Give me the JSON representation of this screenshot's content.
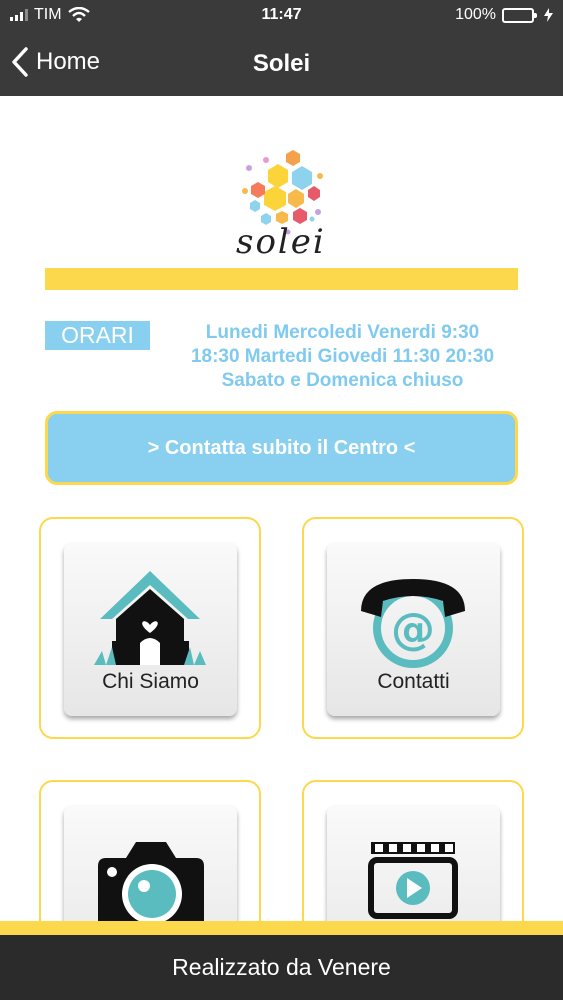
{
  "status_bar": {
    "carrier": "TIM",
    "time": "11:47",
    "battery_percent": "100%",
    "battery_level": 1.0,
    "icons": [
      "signal-icon",
      "wifi-icon",
      "battery-icon",
      "charging-icon"
    ]
  },
  "nav": {
    "back_label": "Home",
    "title": "Solei"
  },
  "logo": {
    "wordmark": "solei"
  },
  "hours": {
    "badge": "ORARI",
    "line1": "Lunedi Mercoledi Venerdi 9:30",
    "line2": "18:30 Martedi Giovedi 11:30 20:30",
    "line3": "Sabato e Domenica chiuso"
  },
  "cta": {
    "label": "> Contatta subito il Centro <"
  },
  "tiles": [
    {
      "label": "Chi Siamo",
      "icon": "house-icon"
    },
    {
      "label": "Contatti",
      "icon": "phone-at-icon"
    },
    {
      "label": "",
      "icon": "camera-icon"
    },
    {
      "label": "",
      "icon": "video-icon"
    }
  ],
  "footer": {
    "text": "Realizzato da Venere"
  },
  "colors": {
    "nav_bg": "#3a3a3a",
    "accent_yellow": "#fcd84c",
    "accent_blue": "#89cfef",
    "hours_text": "#7fcaee",
    "icon_teal": "#5bbcc0",
    "footer_bg": "#2b2b2b"
  }
}
